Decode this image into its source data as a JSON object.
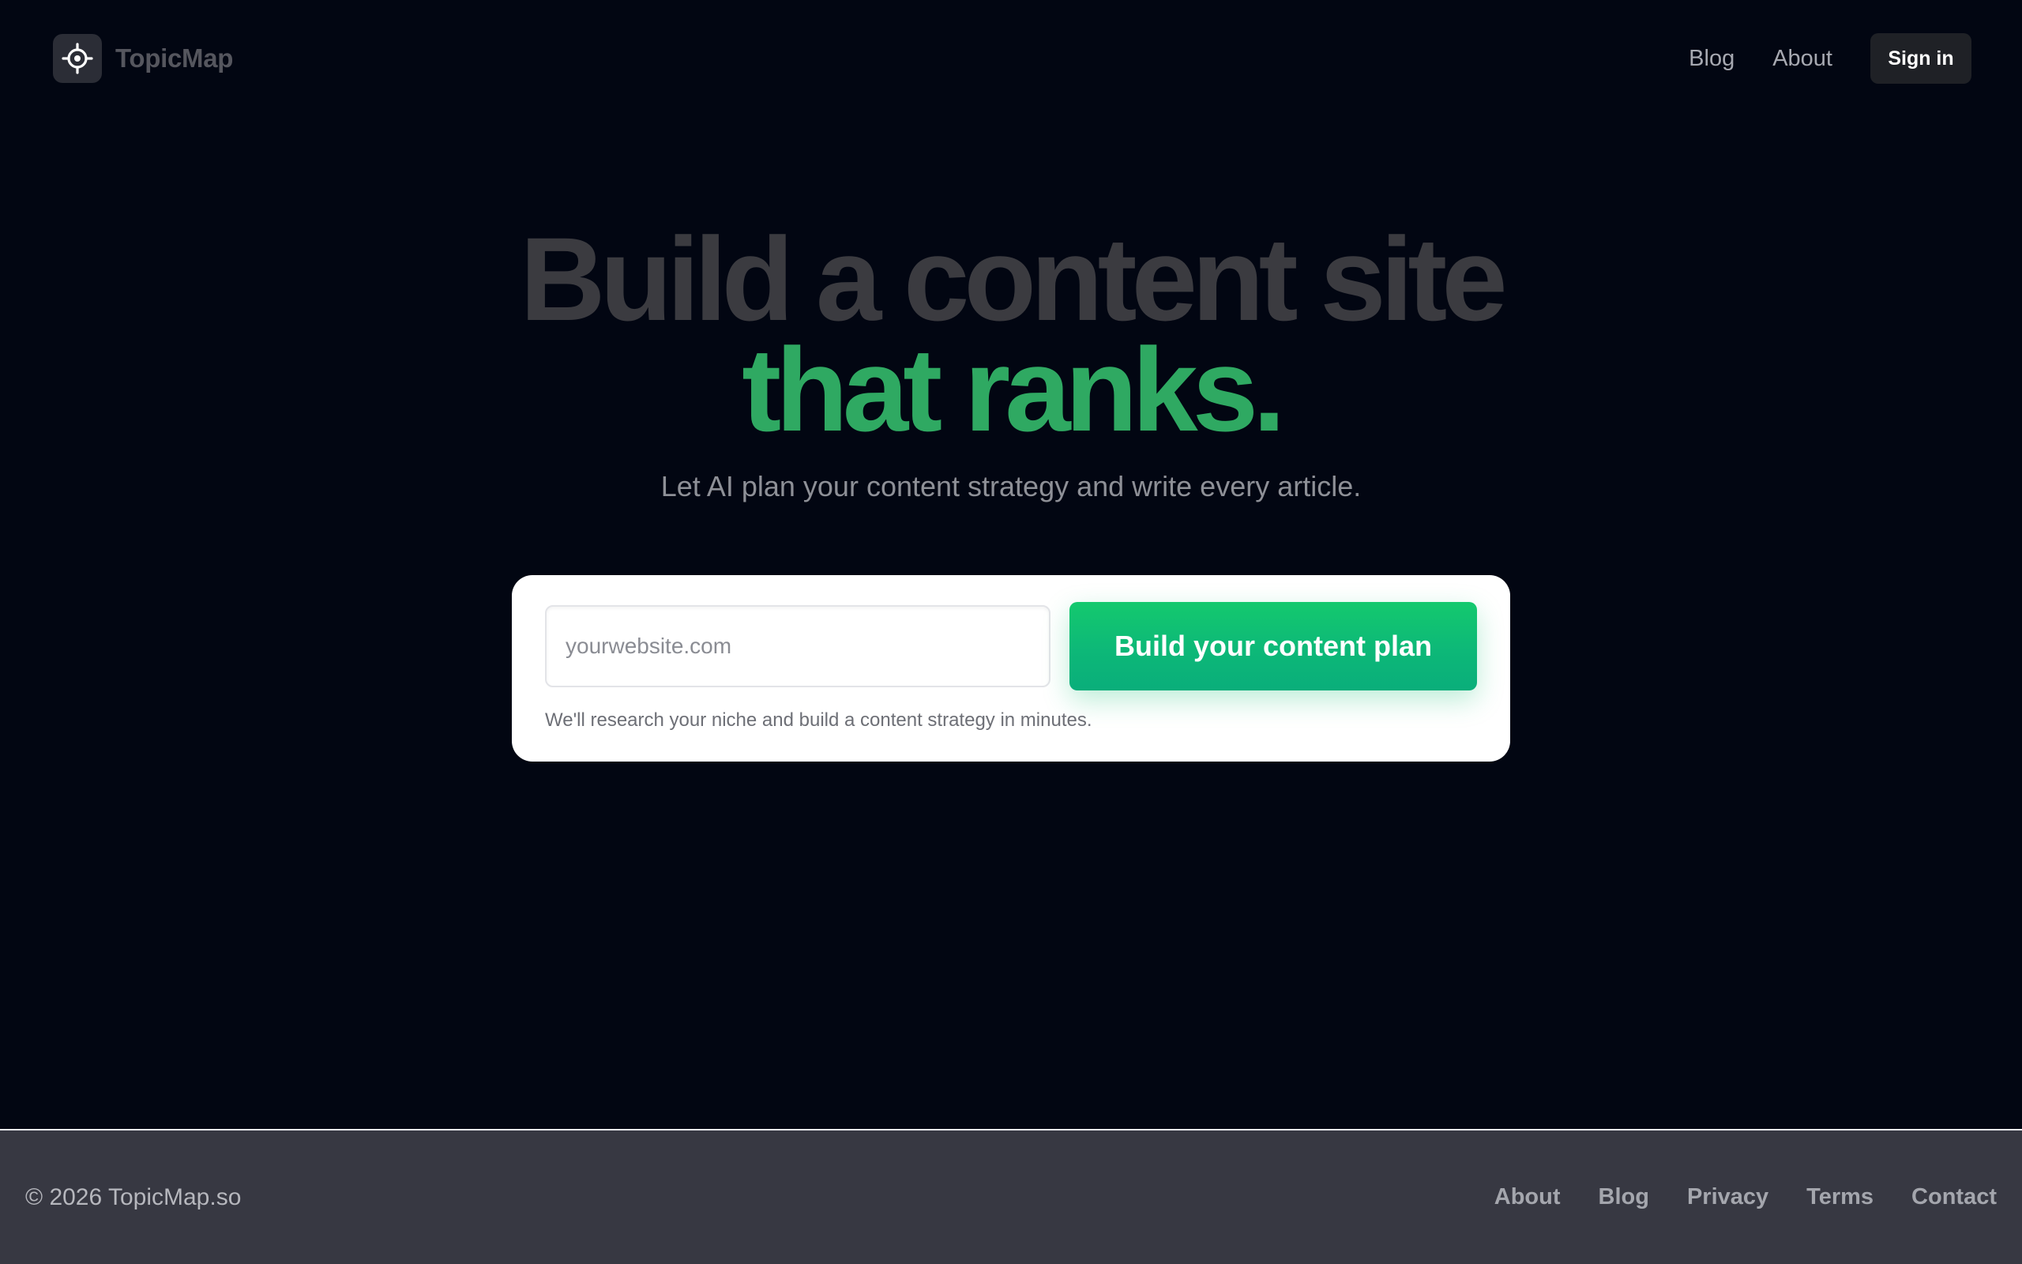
{
  "header": {
    "brand": "TopicMap",
    "logo_icon": "crosshair-target-icon",
    "nav": [
      {
        "label": "Blog"
      },
      {
        "label": "About"
      }
    ],
    "signin_label": "Sign in"
  },
  "hero": {
    "line1": "Build a content site",
    "line2": "that ranks.",
    "subtitle": "Let AI plan your content strategy and write every article."
  },
  "form": {
    "url_placeholder": "yourwebsite.com",
    "url_value": "",
    "submit_label": "Build your content plan",
    "helper_text": "We'll research your niche and build a content strategy in minutes."
  },
  "footer": {
    "copyright": "© 2026 TopicMap.so",
    "links": [
      {
        "label": "About"
      },
      {
        "label": "Blog"
      },
      {
        "label": "Privacy"
      },
      {
        "label": "Terms"
      },
      {
        "label": "Contact"
      }
    ]
  },
  "colors": {
    "background": "#020612",
    "accent_green": "#2fa962",
    "button_green": "#10bf74",
    "footer_bg": "#373842"
  }
}
